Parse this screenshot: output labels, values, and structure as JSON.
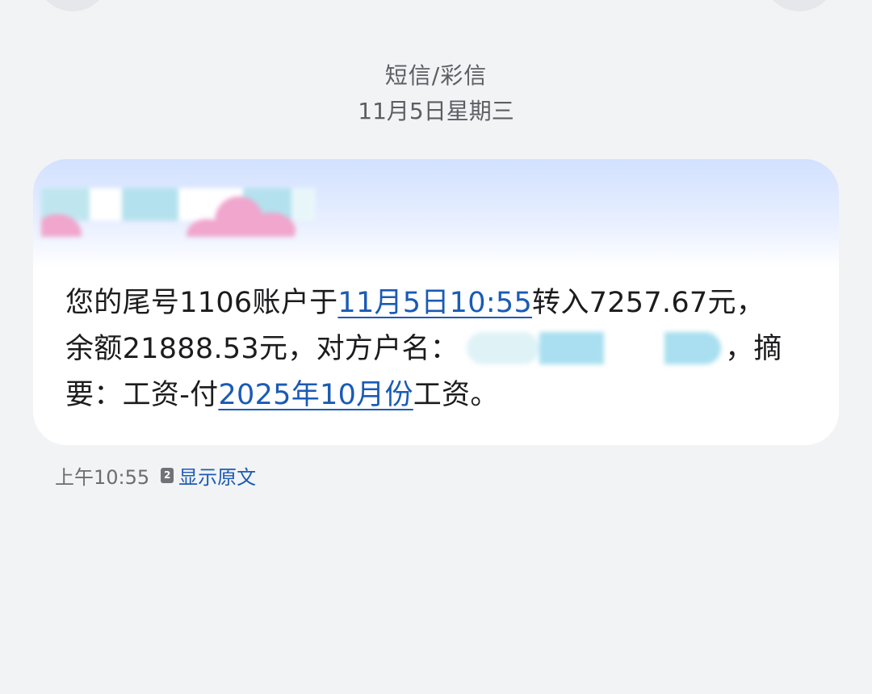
{
  "header": {
    "channel": "短信/彩信",
    "date": "11月5日星期三"
  },
  "message": {
    "part1": "您的尾号1106账户于",
    "link_datetime": "11月5日10:55",
    "part2": "转入7257.67元，",
    "part3": "余额21888.53元，对方户名：",
    "part4": "，摘",
    "part5": "要：工资-付",
    "link_period": "2025年10月份",
    "part6": "工资。"
  },
  "meta": {
    "time": "上午10:55",
    "sim_slot": "2",
    "show_original": "显示原文"
  },
  "colors": {
    "background": "#f2f3f5",
    "link": "#1a5bb5",
    "bubble_top": "#d2e1ff"
  },
  "icons": {
    "sim": "sim-card-2-icon"
  }
}
